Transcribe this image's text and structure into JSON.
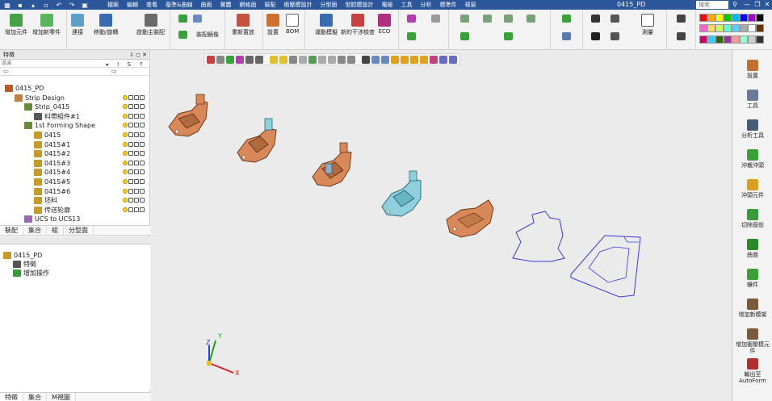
{
  "menu": [
    "檔案",
    "編輯",
    "查看",
    "基準&曲線",
    "曲面",
    "實體",
    "網格面",
    "裝配",
    "衝壓模設計",
    "分型面",
    "型腔模設計",
    "電極",
    "工具",
    "分析",
    "標準件",
    "視窗"
  ],
  "document_title": "0415_PD",
  "search_placeholder": "搜索",
  "window_controls": [
    "?",
    "—",
    "❐",
    "✕"
  ],
  "ribbon": {
    "buttons": {
      "add_component": "增加元件",
      "add_new_part": "增加新零件",
      "connect": "連接",
      "move_rotate": "移動/旋轉",
      "align_master": "啟動主裝配",
      "assembly_array": "裝配鏡像",
      "reposition": "重新置放",
      "settings": "設置",
      "bom": "BOM",
      "mold_open": "運動模擬",
      "new_interference": "新的干涉檢查",
      "eco": "ECO",
      "measure": "測量"
    },
    "palette_colors": [
      "#ff0000",
      "#ffaa00",
      "#ffff00",
      "#00c800",
      "#00b4ff",
      "#0000ff",
      "#a000c8",
      "#000000",
      "#ff66cc",
      "#ffd966",
      "#c8ff64",
      "#64ffc8",
      "#64c8ff",
      "#aaaaaa",
      "#ffffff",
      "#663300",
      "#cc0066",
      "#33ccff",
      "#336600",
      "#993399",
      "#ff9999",
      "#99ffcc",
      "#cccccc",
      "#333333"
    ]
  },
  "panel": {
    "title": "特徵",
    "header_buttons": "⇩ ◻ ✕",
    "filter_placeholder": "過濾",
    "filter_tools": "▸ I S ↑",
    "tree": [
      {
        "label": "0415_PD",
        "level": 0,
        "icon": "#b35a2a",
        "states": false
      },
      {
        "label": "Strip Design",
        "level": 1,
        "icon": "#c08040",
        "states": true
      },
      {
        "label": "Strip_0415",
        "level": 2,
        "icon": "#6a8a3a",
        "states": true
      },
      {
        "label": "料帶組件#1",
        "level": 3,
        "icon": "#555555",
        "states": true
      },
      {
        "label": "1st Forming Shape",
        "level": 2,
        "icon": "#6a8a3a",
        "states": true
      },
      {
        "label": "0415",
        "level": 3,
        "icon": "#c49a2a",
        "states": true
      },
      {
        "label": "0415#1",
        "level": 3,
        "icon": "#c49a2a",
        "states": true
      },
      {
        "label": "0415#2",
        "level": 3,
        "icon": "#c49a2a",
        "states": true
      },
      {
        "label": "0415#3",
        "level": 3,
        "icon": "#c49a2a",
        "states": true
      },
      {
        "label": "0415#4",
        "level": 3,
        "icon": "#c49a2a",
        "states": true
      },
      {
        "label": "0415#5",
        "level": 3,
        "icon": "#c49a2a",
        "states": true
      },
      {
        "label": "0415#6",
        "level": 3,
        "icon": "#c49a2a",
        "states": true
      },
      {
        "label": "坯料",
        "level": 3,
        "icon": "#c49a2a",
        "states": true
      },
      {
        "label": "传送轮廓",
        "level": 3,
        "icon": "#c49a2a",
        "states": true
      },
      {
        "label": "UCS to UCS13",
        "level": 2,
        "icon": "#9a6ab0",
        "states": false
      }
    ],
    "tabs": [
      "裝配",
      "集合",
      "組",
      "分型面"
    ]
  },
  "lower_tree": [
    {
      "label": "0415_PD",
      "level": 0,
      "icon": "#c49a2a"
    },
    {
      "label": "特徵",
      "level": 1,
      "icon": "#555555"
    },
    {
      "label": "增加操作",
      "level": 1,
      "icon": "#3a9a3a"
    }
  ],
  "bottom_tabs": [
    "特徵",
    "集合",
    "M視圖"
  ],
  "axes": {
    "x": "X",
    "y": "Y",
    "z": "Z"
  },
  "right_panel": [
    {
      "label": "設置",
      "icon": "#c07030"
    },
    {
      "label": "工具",
      "icon": "#6a7a9a"
    },
    {
      "label": "分析工具",
      "icon": "#4a5a7a"
    },
    {
      "label": "沖裁沖頭",
      "icon": "#3aa03a"
    },
    {
      "label": "沖頭元件",
      "icon": "#d8a020"
    },
    {
      "label": "切除廢前",
      "icon": "#3a9a3a"
    },
    {
      "label": "曲面",
      "icon": "#2a8a2a"
    },
    {
      "label": "鑲件",
      "icon": "#3aa03a"
    },
    {
      "label": "增加新模架",
      "icon": "#7a5a3a"
    },
    {
      "label": "增加衝壓模元件",
      "icon": "#7a5a3a"
    },
    {
      "label": "輸出至AutoForm",
      "icon": "#b03030"
    }
  ],
  "colors": {
    "accent": "#2b579a",
    "part_copper": "#d9885a",
    "part_cyan": "#8fd0dc",
    "wire": "#3a3adc"
  }
}
